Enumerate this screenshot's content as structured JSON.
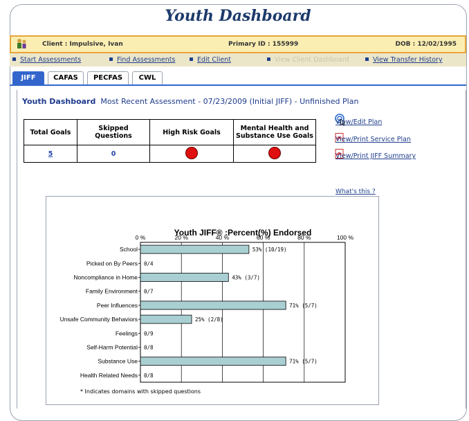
{
  "header": {
    "title": "Youth Dashboard"
  },
  "client": {
    "name": "Client : Impulsive, Ivan",
    "primary_id": "Primary ID : 155999",
    "dob": "DOB : 12/02/1995"
  },
  "links": {
    "start": "Start Assessments",
    "find": "Find Assessments",
    "edit": "Edit Client",
    "view_dashboard": "View Client Dashboard",
    "transfer": "View Transfer History"
  },
  "tabs": [
    "JIFF",
    "CAFAS",
    "PECFAS",
    "CWL"
  ],
  "summary": {
    "label": "Youth Dashboard",
    "text": "Most Recent Assessment - 07/23/2009 (Initial JIFF)   - Unfinished Plan"
  },
  "goals_table": {
    "headers": [
      "Total Goals",
      "Skipped Questions",
      "High Risk Goals",
      "Mental Health and Substance Use Goals"
    ],
    "total_goals": "5",
    "skipped_questions": "0"
  },
  "side_links": {
    "view_edit_plan": "View/Edit Plan",
    "print_service_plan": "View/Print Service Plan",
    "print_jiff_summary": "View/Print JIFF Summary"
  },
  "whats_this": "What's this ?",
  "footnote": "* Indicates domains with skipped questions",
  "colors": {
    "accent": "#3366cc",
    "bar_fill": "#a9cfd3",
    "risk_dot": "#e01010"
  },
  "chart_data": {
    "type": "bar",
    "orientation": "horizontal",
    "title": "Youth JIFF® :Percent(%) Endorsed",
    "xlim": [
      0,
      100
    ],
    "x_ticks": [
      "0 %",
      "20 %",
      "40 %",
      "60 %",
      "80 %",
      "100 %"
    ],
    "categories": [
      "School",
      "Picked on By Peers",
      "Noncompliance in Home",
      "Family Environment",
      "Peer Influences",
      "Unsafe Community Behaviors",
      "Feelings",
      "Self-Harm Potential",
      "Substance Use",
      "Health Related Needs"
    ],
    "values": [
      53,
      0,
      43,
      0,
      71,
      25,
      0,
      0,
      71,
      0
    ],
    "labels": [
      "53%  (10/19)",
      "0/4",
      "43%  (3/7)",
      "0/7",
      "71%  (5/7)",
      "25%  (2/8)",
      "0/9",
      "0/8",
      "71%  (5/7)",
      "0/8"
    ]
  }
}
